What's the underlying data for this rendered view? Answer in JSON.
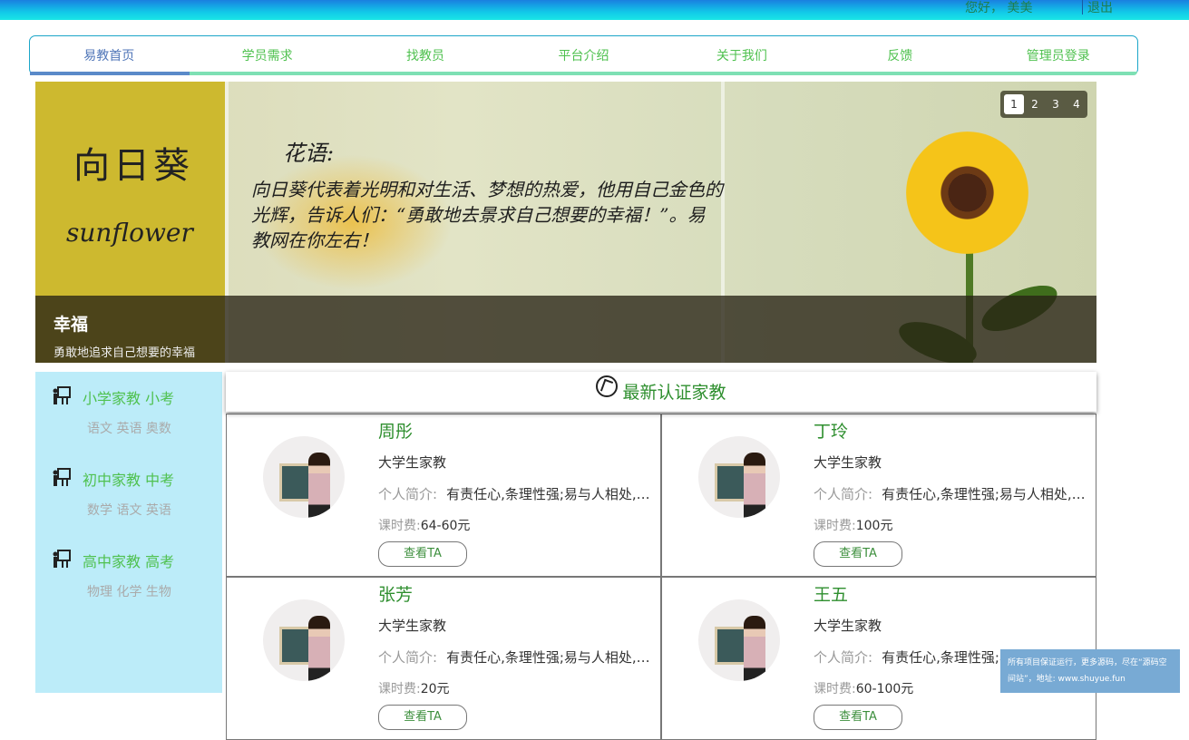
{
  "topbar": {
    "greeting": "您好，  美美",
    "logout": "退出"
  },
  "nav": {
    "items": [
      "易教首页",
      "学员需求",
      "找教员",
      "平台介绍",
      "关于我们",
      "反馈",
      "管理员登录"
    ],
    "active_index": 0
  },
  "banner": {
    "left_title": "向日葵",
    "left_sub": "sunflower",
    "poem_head": "花语:",
    "poem_body": "向日葵代表着光明和对生活、梦想的热爱，他用自己金色的光辉，告诉人们：“勇敢地去景求自己想要的幸福！”。易教网在你左右！",
    "pager": [
      "1",
      "2",
      "3",
      "4"
    ],
    "pager_active": 0,
    "caption_title": "幸福",
    "caption_sub": "勇敢地追求自己想要的幸福"
  },
  "sidebar": {
    "categories": [
      {
        "title": "小学家教 小考",
        "subjects": "语文 英语 奥数"
      },
      {
        "title": "初中家教 中考",
        "subjects": "数学 语文 英语"
      },
      {
        "title": "高中家教 高考",
        "subjects": "物理 化学 生物"
      }
    ]
  },
  "main": {
    "heading": "最新认证家教",
    "intro_label": "个人简介:",
    "fee_label": "课时费:",
    "button_label": "查看TA",
    "tutors": [
      {
        "name": "周彤",
        "type": "大学生家教",
        "intro": "有责任心,条理性强;易与人相处,善于沟通",
        "fee": "64-60元"
      },
      {
        "name": "丁玲",
        "type": "大学生家教",
        "intro": "有责任心,条理性强;易与人相处,善于沟通",
        "fee": "100元"
      },
      {
        "name": "张芳",
        "type": "大学生家教",
        "intro": "有责任心,条理性强;易与人相处,善于沟通",
        "fee": "20元"
      },
      {
        "name": "王五",
        "type": "大学生家教",
        "intro": "有责任心,条理性强;易与人相处,善于沟通",
        "fee": "60-100元"
      }
    ]
  },
  "toast": {
    "text": "所有项目保证运行，更多源码，尽在“源码空间站”，地址: www.shuyue.fun"
  }
}
